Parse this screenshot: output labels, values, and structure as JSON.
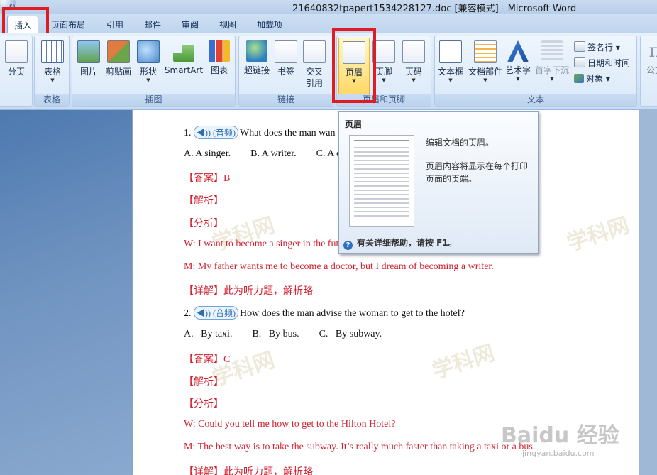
{
  "window": {
    "title": "21640832tpapert1534228127.doc [兼容模式] - Microsoft Word"
  },
  "tabs": [
    {
      "label": "插入",
      "active": true
    },
    {
      "label": "页面布局"
    },
    {
      "label": "引用"
    },
    {
      "label": "邮件"
    },
    {
      "label": "审阅"
    },
    {
      "label": "视图"
    },
    {
      "label": "加载项"
    }
  ],
  "ribbon": {
    "pages": {
      "fenye": "分页"
    },
    "table": {
      "btn": "表格",
      "group": "表格"
    },
    "illus": {
      "picture": "图片",
      "clipart": "剪贴画",
      "shape": "形状",
      "smartart": "SmartArt",
      "chart": "图表",
      "group": "插图"
    },
    "links": {
      "hyperlink": "超链接",
      "bookmark": "书签",
      "xref1": "交叉",
      "xref2": "引用",
      "group": "链接"
    },
    "hf": {
      "header": "页眉",
      "footer": "页脚",
      "pagenum": "页码",
      "group": "页眉和页脚"
    },
    "text": {
      "textbox": "文本框",
      "parts": "文档部件",
      "wordart": "艺术字",
      "dropcap": "首字下沉",
      "sigline": "签名行",
      "datetime": "日期和时间",
      "object": "对象",
      "group": "文本"
    },
    "symbols": {
      "formula": "公式"
    }
  },
  "tooltip": {
    "title": "页眉",
    "desc1": "编辑文档的页眉。",
    "desc2": "页眉内容将显示在每个打印页面的页端。",
    "help": "有关详细帮助，请按 F1。"
  },
  "doc": {
    "audio_label": "(音频)",
    "q1": "1.",
    "q1_text": "What does the man wan",
    "q1_options": "A. A singer.        B. A writer.        C. A d",
    "ans_c1": "【答案】B",
    "jiexi": "【解析】",
    "fenxi": "【分析】",
    "w1": "W: I want to become a singer in the fut",
    "m1": "M: My father wants me to become a doctor, but I dream of becoming a writer.",
    "detail": "【详解】此为听力题，解析略",
    "q2": "2.",
    "q2_text": "How does the man advise the woman to get to the hotel?",
    "q2_options": "A.   By taxi.        B.   By bus.        C.   By subway.",
    "ans_c2": "【答案】C",
    "w2": "W: Could you tell me how to get to the Hilton Hotel?",
    "m2": "M: The best way is to take the subway. It’s really much faster than taking a taxi or a bus.",
    "watermark": "学科网"
  },
  "baidu": {
    "logo": "Baidu 经验",
    "sub": "jingyan.baidu.com"
  }
}
